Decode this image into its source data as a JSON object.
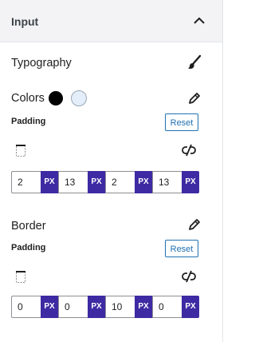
{
  "panel": {
    "title": "Input",
    "collapse_icon": "chevron-up-icon"
  },
  "typography": {
    "label": "Typography",
    "icon": "brush-icon"
  },
  "colors": {
    "label": "Colors",
    "icon": "pencil-icon",
    "swatches": [
      "#000000",
      "#e4eefa"
    ]
  },
  "padding_1": {
    "label": "Padding",
    "reset_label": "Reset",
    "values": [
      "2",
      "13",
      "2",
      "13"
    ],
    "units": [
      "PX",
      "PX",
      "PX",
      "PX"
    ]
  },
  "border": {
    "label": "Border",
    "icon": "pencil-icon"
  },
  "padding_2": {
    "label": "Padding",
    "reset_label": "Reset",
    "values": [
      "0",
      "0",
      "10",
      "0"
    ],
    "units": [
      "PX",
      "PX",
      "PX",
      "PX"
    ]
  },
  "accent_color": "#3e2aa3",
  "link_color": "#2271b1"
}
